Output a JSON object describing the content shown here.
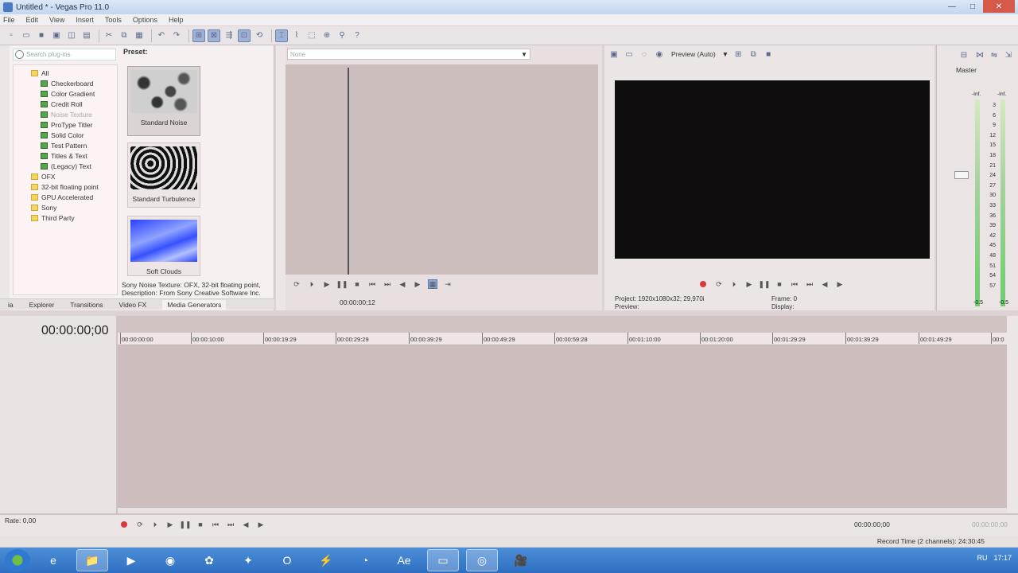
{
  "window": {
    "title": "Untitled * - Vegas Pro 11.0",
    "minimize": "—",
    "maximize": "□",
    "close": "✕"
  },
  "menu": [
    "File",
    "Edit",
    "View",
    "Insert",
    "Tools",
    "Options",
    "Help"
  ],
  "plugins": {
    "search_placeholder": "Search plug-ins",
    "tree": [
      {
        "label": "All",
        "type": "folder",
        "level": 1
      },
      {
        "label": "Checkerboard",
        "type": "plug",
        "level": 2
      },
      {
        "label": "Color Gradient",
        "type": "plug",
        "level": 2
      },
      {
        "label": "Credit Roll",
        "type": "plug",
        "level": 2
      },
      {
        "label": "Noise Texture",
        "type": "plug",
        "level": 2,
        "selected": true
      },
      {
        "label": "ProType Titler",
        "type": "plug",
        "level": 2
      },
      {
        "label": "Solid Color",
        "type": "plug",
        "level": 2
      },
      {
        "label": "Test Pattern",
        "type": "plug",
        "level": 2
      },
      {
        "label": "Titles & Text",
        "type": "plug",
        "level": 2
      },
      {
        "label": "(Legacy) Text",
        "type": "plug",
        "level": 2
      },
      {
        "label": "OFX",
        "type": "folder",
        "level": 1
      },
      {
        "label": "32-bit floating point",
        "type": "folder",
        "level": 1
      },
      {
        "label": "GPU Accelerated",
        "type": "folder",
        "level": 1
      },
      {
        "label": "Sony",
        "type": "folder",
        "level": 1
      },
      {
        "label": "Third Party",
        "type": "folder",
        "level": 1
      }
    ],
    "preset_title": "Preset:",
    "presets": [
      "Standard Noise",
      "Standard Turbulence",
      "Soft Clouds"
    ],
    "description": "Sony Noise Texture: OFX, 32-bit floating point, Description: From Sony Creative Software Inc.",
    "tabs": [
      "ia",
      "Explorer",
      "Transitions",
      "Video FX",
      "Media Generators"
    ]
  },
  "trimmer": {
    "select_value": "None",
    "timecode": "00:00:00;12"
  },
  "preview": {
    "mode": "Preview (Auto)",
    "project_label": "Project:",
    "project_value": "1920x1080x32; 29,970i",
    "preview_label": "Preview:",
    "frame_label": "Frame:",
    "frame_value": "0",
    "display_label": "Display:"
  },
  "master": {
    "label": "Master",
    "left_inf": "-Inf.",
    "right_inf": "-Inf.",
    "scale": [
      "3",
      "6",
      "9",
      "12",
      "15",
      "18",
      "21",
      "24",
      "27",
      "30",
      "33",
      "36",
      "39",
      "42",
      "45",
      "48",
      "51",
      "54",
      "57"
    ],
    "bottom_left": "-0.5",
    "bottom_right": "-0.5"
  },
  "timeline": {
    "cursor_time": "00:00:00;00",
    "ticks": [
      "00:00:00:00",
      "00:00:10:00",
      "00:00:19:29",
      "00:00:29:29",
      "00:00:39:29",
      "00:00:49:29",
      "00:00:59:28",
      "00:01:10:00",
      "00:01:20:00",
      "00:01:29:29",
      "00:01:39:29",
      "00:01:49:29",
      "00:0"
    ]
  },
  "transport": {
    "rate": "Rate: 0,00",
    "time": "00:00:00;00",
    "time2": "00:00:00;00"
  },
  "status": {
    "record_time": "Record Time (2 channels): 24:30:45"
  },
  "taskbar": {
    "apps": [
      "e",
      "📁",
      "▶",
      "◉",
      "✿",
      "✦",
      "O",
      "⚡",
      "◔",
      "Ae",
      "▭",
      "◎",
      "🎥"
    ],
    "tray_lang": "RU",
    "clock": "17:17"
  }
}
